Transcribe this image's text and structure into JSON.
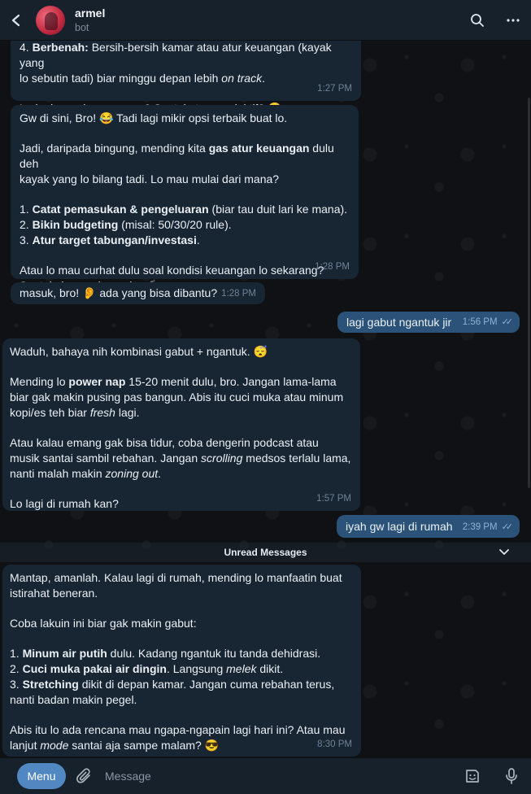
{
  "chat": {
    "name": "armel",
    "status": "bot"
  },
  "icons": {
    "back": "chevron-left-icon",
    "search": "search-icon",
    "more": "more-vertical-icon",
    "attach": "paperclip-icon",
    "sticker": "sticker-icon",
    "mic": "microphone-icon"
  },
  "colors": {
    "header_bg": "#17212b",
    "incoming_bubble": "#182533",
    "outgoing_bubble": "#2b5278",
    "accent": "#5288c1"
  },
  "messages": {
    "m1": {
      "time": "1:27 PM",
      "l1_num": "4. ",
      "l1_bold": "Berbenah:",
      "l1_rest": " Bersih-bersih kamar atau atur keuangan (kayak yang",
      "l2_pre": "lo sebutin tadi) biar minggu depan lebih ",
      "l2_ital": "on track",
      "l2_post": ".",
      "p2_pre": "Lo lagi ",
      "p2_ital": "mood",
      "p2_post": " yang mana? Santai atau produktif? 😎"
    },
    "m2": {
      "time": "1:28 PM",
      "p1": "Gw di sini, Bro! 😂 Tadi lagi mikir opsi terbaik buat lo.",
      "p2_l1_pre": "Jadi, daripada bingung, mending kita ",
      "p2_l1_bold": "gas atur keuangan",
      "p2_l1_post": " dulu deh",
      "p2_l2": "kayak yang lo bilang tadi. Lo mau mulai dari mana?",
      "i1_num": "1. ",
      "i1_bold": "Catat pemasukan & pengeluaran",
      "i1_rest": " (biar tau duit lari ke mana).",
      "i2_num": "2. ",
      "i2_bold": "Bikin budgeting",
      "i2_rest": " (misal: 50/30/20 rule).",
      "i3_num": "3. ",
      "i3_bold": "Atur target tabungan/investasi",
      "i3_rest": ".",
      "p4_l1": "Atau lo mau curhat dulu soal kondisi keuangan lo sekarang?",
      "p4_l2": "Santai aja, gw dengerin. ☕"
    },
    "m3": {
      "time": "1:28 PM",
      "text": "masuk, bro! 👂 ada yang bisa dibantu?"
    },
    "m4": {
      "time": "1:56 PM",
      "text": "lagi gabut ngantuk jir"
    },
    "m5": {
      "time": "1:57 PM",
      "p1": "Waduh, bahaya nih kombinasi gabut + ngantuk. 😴",
      "p2_l1_pre": "Mending lo ",
      "p2_l1_bold": "power nap",
      "p2_l1_post": " 15-20 menit dulu, bro. Jangan lama-lama",
      "p2_l2": "biar gak makin pusing pas bangun. Abis itu cuci muka atau minum",
      "p2_l3_pre": "kopi/es teh biar ",
      "p2_l3_ital": "fresh",
      "p2_l3_post": " lagi.",
      "p3_l1": "Atau kalau emang gak bisa tidur, coba dengerin podcast atau",
      "p3_l2_pre": "musik santai sambil rebahan. Jangan ",
      "p3_l2_ital": "scrolling",
      "p3_l2_post": " medsos terlalu lama,",
      "p3_l3_pre": "nanti malah makin ",
      "p3_l3_ital": "zoning out",
      "p3_l3_post": ".",
      "p4": "Lo lagi di rumah kan?"
    },
    "m6": {
      "time": "2:39 PM",
      "text": "iyah gw lagi di rumah"
    },
    "m7": {
      "time": "8:30 PM",
      "p1_l1": "Mantap, amanlah. Kalau lagi di rumah, mending lo manfaatin buat",
      "p1_l2": "istirahat beneran.",
      "p2": "Coba lakuin ini biar gak makin gabut:",
      "i1_num": "1. ",
      "i1_bold": "Minum air putih",
      "i1_rest": " dulu. Kadang ngantuk itu tanda dehidrasi.",
      "i2_num": "2. ",
      "i2_bold": "Cuci muka pakai air dingin",
      "i2_mid": ". Langsung ",
      "i2_ital": "melek",
      "i2_rest": " dikit.",
      "i3_num": "3. ",
      "i3_bold": "Stretching",
      "i3_rest": " dikit di depan kamar. Jangan cuma rebahan terus,",
      "i3_l2": "nanti badan makin pegel.",
      "p4_l1": "Abis itu lo ada rencana mau ngapa-ngapain lagi hari ini? Atau mau",
      "p4_l2_pre": "lanjut ",
      "p4_l2_ital": "mode",
      "p4_l2_post": " santai aja sampe malam? 😎"
    }
  },
  "divider": {
    "label": "Unread Messages"
  },
  "composer": {
    "menu_label": "Menu",
    "placeholder": "Message"
  }
}
